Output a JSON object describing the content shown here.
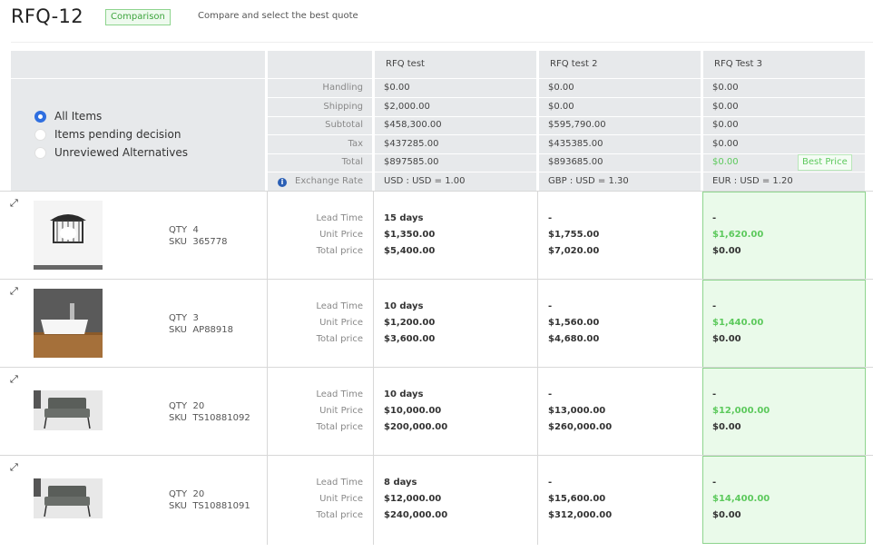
{
  "header": {
    "title": "RFQ-12",
    "badge": "Comparison",
    "subtitle": "Compare and select the best quote"
  },
  "columns": [
    "RFQ test",
    "RFQ test 2",
    "RFQ Test 3"
  ],
  "filters": [
    {
      "label": "All Items",
      "selected": true
    },
    {
      "label": "Items pending decision",
      "selected": false
    },
    {
      "label": "Unreviewed Alternatives",
      "selected": false
    }
  ],
  "summary": {
    "labels": [
      "Handling",
      "Shipping",
      "Subtotal",
      "Tax",
      "Total",
      "Exchange Rate"
    ],
    "quotes": [
      [
        "$0.00",
        "$2,000.00",
        "$458,300.00",
        "$437285.00",
        "$897585.00",
        "USD : USD = 1.00"
      ],
      [
        "$0.00",
        "$0.00",
        "$595,790.00",
        "$435385.00",
        "$893685.00",
        "GBP : USD = 1.30"
      ],
      [
        "$0.00",
        "$0.00",
        "$0.00",
        "$0.00",
        "$0.00",
        "EUR : USD = 1.20"
      ]
    ],
    "best_price_label": "Best Price"
  },
  "item_labels": {
    "qty": "QTY",
    "sku": "SKU",
    "lead_time": "Lead Time",
    "unit_price": "Unit Price",
    "total_price": "Total price"
  },
  "items": [
    {
      "qty": "4",
      "sku": "365778",
      "image": "pendant-lamp",
      "quotes": [
        [
          "15 days",
          "$1,350.00",
          "$5,400.00"
        ],
        [
          "-",
          "$1,755.00",
          "$7,020.00"
        ],
        [
          "-",
          "$1,620.00",
          "$0.00"
        ]
      ]
    },
    {
      "qty": "3",
      "sku": "AP88918",
      "image": "vessel-sink",
      "quotes": [
        [
          "10 days",
          "$1,200.00",
          "$3,600.00"
        ],
        [
          "-",
          "$1,560.00",
          "$4,680.00"
        ],
        [
          "-",
          "$1,440.00",
          "$0.00"
        ]
      ]
    },
    {
      "qty": "20",
      "sku": "TS10881092",
      "image": "lounge-chair",
      "quotes": [
        [
          "10 days",
          "$10,000.00",
          "$200,000.00"
        ],
        [
          "-",
          "$13,000.00",
          "$260,000.00"
        ],
        [
          "-",
          "$12,000.00",
          "$0.00"
        ]
      ]
    },
    {
      "qty": "20",
      "sku": "TS10881091",
      "image": "lounge-chair",
      "quotes": [
        [
          "8 days",
          "$12,000.00",
          "$240,000.00"
        ],
        [
          "-",
          "$15,600.00",
          "$312,000.00"
        ],
        [
          "-",
          "$14,400.00",
          "$0.00"
        ]
      ]
    }
  ],
  "colors": {
    "accent_green": "#5cc95c",
    "radio_blue": "#2f6fe0",
    "header_gray": "#e7e9eb"
  }
}
